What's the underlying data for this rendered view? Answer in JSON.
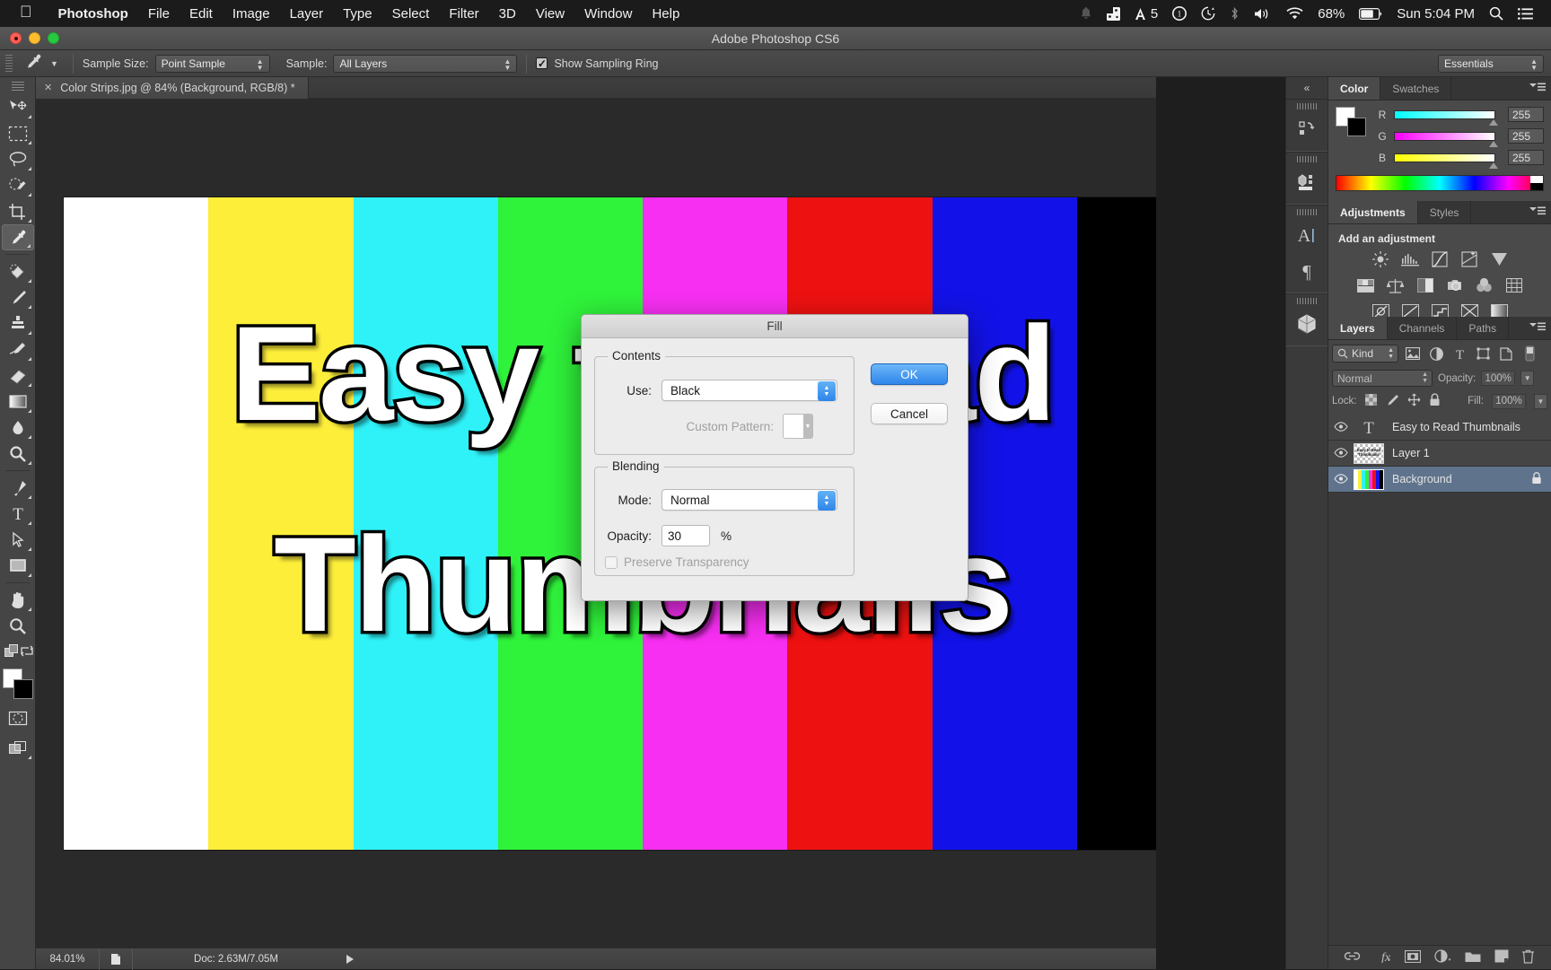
{
  "macbar": {
    "apple_icon": "apple-icon",
    "menus": [
      "Photoshop",
      "File",
      "Edit",
      "Image",
      "Layer",
      "Type",
      "Select",
      "Filter",
      "3D",
      "View",
      "Window",
      "Help"
    ],
    "status": {
      "notification_icon": "bell-icon",
      "dropbox_icon": "dropbox-icon",
      "adobe_icon": "adobe-icon",
      "adobe_count": "5",
      "onepassword_icon": "onepassword-icon",
      "timemachine_icon": "clock-icon",
      "bluetooth_icon": "bluetooth-icon",
      "volume_icon": "speaker-icon",
      "wifi_icon": "wifi-icon",
      "battery_percent": "68%",
      "battery_icon": "battery-icon",
      "clock": "Sun 5:04 PM",
      "search_icon": "search-icon",
      "menu_icon": "list-icon"
    }
  },
  "titlebar": {
    "app_title": "Adobe Photoshop CS6"
  },
  "options_bar": {
    "tool_icon": "eyedropper-icon",
    "tool_preset_arrow": "chevron-down-icon",
    "sample_size_label": "Sample Size:",
    "sample_size_value": "Point Sample",
    "sample_label": "Sample:",
    "sample_value": "All Layers",
    "show_sampling_ring_label": "Show Sampling Ring",
    "show_sampling_ring_checked": "✓",
    "workspace": "Essentials"
  },
  "toolbar": {
    "tools": [
      {
        "name": "move-tool",
        "glyph": "move"
      },
      {
        "name": "marquee-tool",
        "glyph": "marquee"
      },
      {
        "name": "lasso-tool",
        "glyph": "lasso"
      },
      {
        "name": "quick-selection-tool",
        "glyph": "quickselect"
      },
      {
        "name": "crop-tool",
        "glyph": "crop"
      },
      {
        "name": "eyedropper-tool",
        "glyph": "eyedropper",
        "active": true
      },
      {
        "name": "healing-brush-tool",
        "glyph": "heal"
      },
      {
        "name": "brush-tool",
        "glyph": "brush"
      },
      {
        "name": "clone-stamp-tool",
        "glyph": "stamp"
      },
      {
        "name": "history-brush-tool",
        "glyph": "historybrush"
      },
      {
        "name": "eraser-tool",
        "glyph": "eraser"
      },
      {
        "name": "gradient-tool",
        "glyph": "gradient"
      },
      {
        "name": "blur-tool",
        "glyph": "blur"
      },
      {
        "name": "dodge-tool",
        "glyph": "dodge"
      },
      {
        "name": "pen-tool",
        "glyph": "pen"
      },
      {
        "name": "type-tool",
        "glyph": "type"
      },
      {
        "name": "path-selection-tool",
        "glyph": "pathselect"
      },
      {
        "name": "rectangle-tool",
        "glyph": "rectangle"
      },
      {
        "name": "hand-tool",
        "glyph": "hand"
      },
      {
        "name": "zoom-tool",
        "glyph": "zoom"
      }
    ],
    "foreground_color": "#ffffff",
    "background_color": "#000000",
    "quickmask_icon": "quick-mask-icon",
    "screenmode_icon": "screen-mode-icon"
  },
  "document": {
    "tab_title": "Color Strips.jpg @ 84% (Background, RGB/8) *",
    "close_icon": "close-icon",
    "strips": [
      {
        "name": "white",
        "color": "#ffffff"
      },
      {
        "name": "yellow",
        "color": "#fdee3a"
      },
      {
        "name": "cyan",
        "color": "#2ff2f8"
      },
      {
        "name": "green",
        "color": "#2ff23a"
      },
      {
        "name": "magenta",
        "color": "#f72ff2"
      },
      {
        "name": "red",
        "color": "#ee1111"
      },
      {
        "name": "blue",
        "color": "#1212e8"
      },
      {
        "name": "black",
        "color": "#000000"
      }
    ],
    "artwork_line1": "Easy to Read",
    "artwork_line2": "Thumbnails"
  },
  "status_bar": {
    "zoom": "84.01%",
    "doc_icon": "document-icon",
    "doc_info": "Doc: 2.63M/7.05M",
    "arrow_icon": "play-arrow-icon"
  },
  "minidock": {
    "collapse_icon": "collapse-icon",
    "buttons": [
      {
        "name": "history-panel-icon"
      },
      {
        "name": "properties-panel-icon"
      },
      {
        "name": "character-panel-icon"
      },
      {
        "name": "paragraph-panel-icon"
      },
      {
        "name": "3d-panel-icon"
      }
    ]
  },
  "color_panel": {
    "tabs": [
      "Color",
      "Swatches"
    ],
    "selected_tab": "Color",
    "menu_icon": "panel-menu-icon",
    "channels": [
      {
        "label": "R",
        "value": "255",
        "gradient_from": "#00ffff",
        "gradient_to": "#ffffff"
      },
      {
        "label": "G",
        "value": "255",
        "gradient_from": "#ff00ff",
        "gradient_to": "#ffffff"
      },
      {
        "label": "B",
        "value": "255",
        "gradient_from": "#ffff00",
        "gradient_to": "#ffffff"
      }
    ],
    "foreground_color": "#ffffff",
    "background_color": "#000000"
  },
  "adjustments_panel": {
    "tabs": [
      "Adjustments",
      "Styles"
    ],
    "selected_tab": "Adjustments",
    "menu_icon": "panel-menu-icon",
    "heading": "Add an adjustment",
    "icons": [
      [
        "brightness-contrast-icon",
        "levels-icon",
        "curves-icon",
        "exposure-icon",
        "vibrance-icon"
      ],
      [
        "hue-saturation-icon",
        "color-balance-icon",
        "black-white-icon",
        "photo-filter-icon",
        "channel-mixer-icon",
        "color-lookup-icon"
      ],
      [
        "invert-icon",
        "posterize-icon",
        "threshold-icon",
        "selective-color-icon",
        "gradient-map-icon"
      ]
    ]
  },
  "layers_panel": {
    "tabs": [
      "Layers",
      "Channels",
      "Paths"
    ],
    "selected_tab": "Layers",
    "menu_icon": "panel-menu-icon",
    "filter_label": "Kind",
    "filter_icon": "search-icon",
    "filter_type_icons": [
      "pixel-filter-icon",
      "adjustment-filter-icon",
      "type-filter-icon",
      "shape-filter-icon",
      "smartobject-filter-icon"
    ],
    "filter_toggle_icon": "filter-toggle-icon",
    "blend_mode": "Normal",
    "opacity_label": "Opacity:",
    "opacity_value": "100%",
    "lock_label": "Lock:",
    "lock_icons": [
      "lock-transparency-icon",
      "lock-image-icon",
      "lock-position-icon",
      "lock-all-icon"
    ],
    "fill_label": "Fill:",
    "fill_value": "100%",
    "layers": [
      {
        "name": "Easy to Read Thumbnails",
        "type": "text",
        "visible": true,
        "selected": false,
        "locked": false
      },
      {
        "name": "Layer 1",
        "type": "raster",
        "visible": true,
        "selected": false,
        "locked": false
      },
      {
        "name": "Background",
        "type": "background",
        "visible": true,
        "selected": true,
        "locked": true
      }
    ],
    "bottom_icons": [
      "link-layers-icon",
      "layer-style-icon",
      "layer-mask-icon",
      "adjustment-layer-icon",
      "new-group-icon",
      "new-layer-icon",
      "delete-layer-icon"
    ]
  },
  "fill_dialog": {
    "title": "Fill",
    "contents_legend": "Contents",
    "use_label": "Use:",
    "use_value": "Black",
    "custom_pattern_label": "Custom Pattern:",
    "blending_legend": "Blending",
    "mode_label": "Mode:",
    "mode_value": "Normal",
    "opacity_label": "Opacity:",
    "opacity_value": "30",
    "percent_label": "%",
    "preserve_transparency_label": "Preserve Transparency",
    "ok_label": "OK",
    "cancel_label": "Cancel",
    "ok_color": "#2f86ea"
  }
}
